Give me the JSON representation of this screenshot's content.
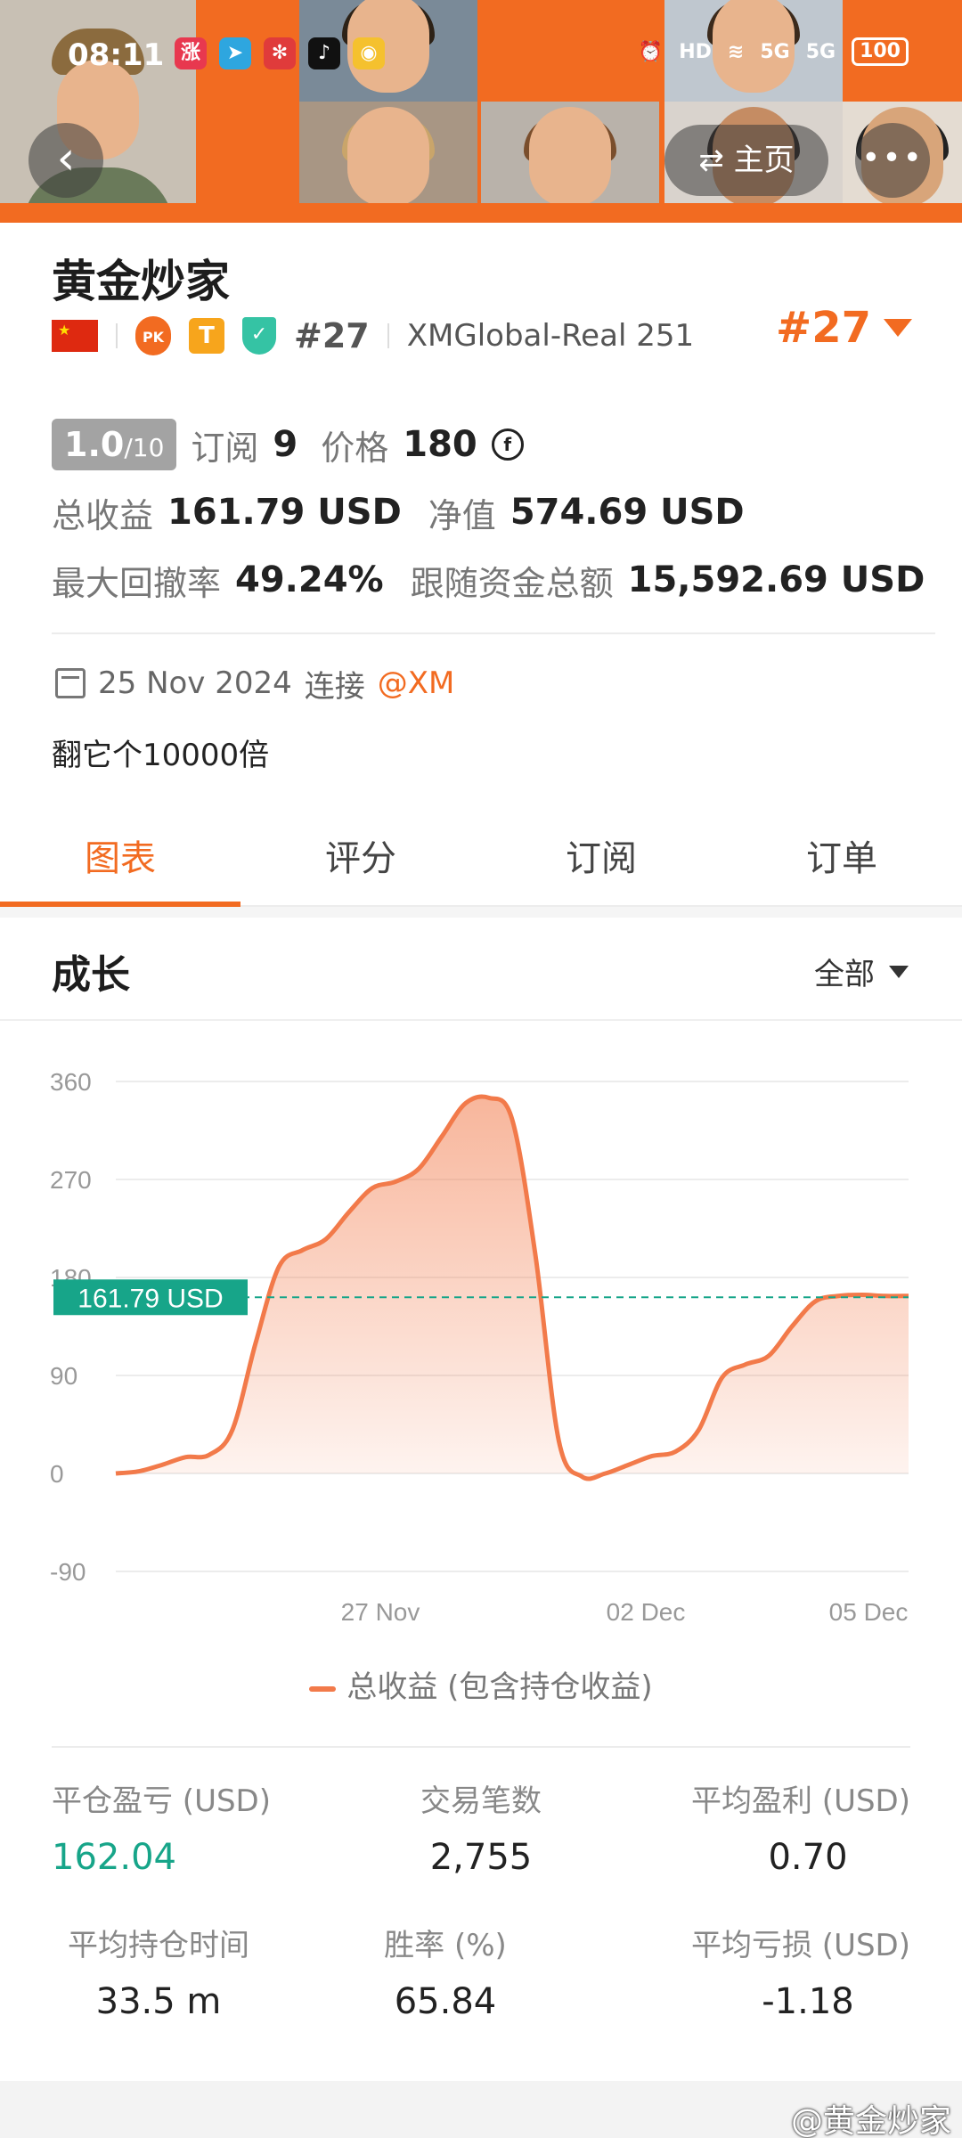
{
  "status_bar": {
    "time": "08:11",
    "network": "5G",
    "battery": "100"
  },
  "nav": {
    "home_label": "⇄ 主页"
  },
  "profile": {
    "name": "黄金炒家",
    "rank": "#27",
    "account": "XMGlobal-Real 251",
    "rank_big": "#27"
  },
  "stats": {
    "score": "1.0",
    "score_max": "/10",
    "subscribe_label": "订阅",
    "subscribe_count": "9",
    "price_label": "价格",
    "price_value": "180",
    "total_profit_label": "总收益",
    "total_profit_value": "161.79 USD",
    "net_value_label": "净值",
    "net_value_value": "574.69 USD",
    "max_drawdown_label": "最大回撤率",
    "max_drawdown_value": "49.24%",
    "follow_funds_label": "跟随资金总额",
    "follow_funds_value": "15,592.69 USD"
  },
  "connection": {
    "date": "25 Nov 2024",
    "connect_label": "连接",
    "broker": "@XM"
  },
  "bio": "翻它个10000倍",
  "tabs": [
    {
      "label": "图表",
      "active": true
    },
    {
      "label": "评分",
      "active": false
    },
    {
      "label": "订阅",
      "active": false
    },
    {
      "label": "订单",
      "active": false
    }
  ],
  "section": {
    "title": "成长",
    "range": "全部"
  },
  "chart_data": {
    "type": "area",
    "y_ticks": [
      "360",
      "270",
      "180",
      "90",
      "0",
      "-90"
    ],
    "ylim": [
      -90,
      360
    ],
    "x_tick_labels": [
      "27 Nov",
      "02 Dec",
      "05 Dec"
    ],
    "current_value_label": "161.79 USD",
    "current_value": 161.79,
    "series": [
      {
        "name": "总收益 (包含持仓收益)",
        "color": "#f27a4a",
        "values": [
          0,
          2,
          8,
          15,
          17,
          40,
          120,
          190,
          205,
          215,
          240,
          262,
          268,
          280,
          310,
          340,
          345,
          325,
          200,
          30,
          -3,
          0,
          8,
          16,
          20,
          40,
          88,
          100,
          108,
          135,
          158,
          163,
          164,
          163,
          163
        ]
      }
    ]
  },
  "legend": {
    "label": "总收益 (包含持仓收益)"
  },
  "metrics": [
    {
      "label": "平仓盈亏 (USD)",
      "value": "162.04",
      "color": "green"
    },
    {
      "label": "交易笔数",
      "value": "2,755",
      "color": "default"
    },
    {
      "label": "平均盈利 (USD)",
      "value": "0.70",
      "color": "default"
    },
    {
      "label": "平均持仓时间",
      "value": "33.5 m",
      "color": "default"
    },
    {
      "label": "胜率 (%)",
      "value": "65.84",
      "color": "default"
    },
    {
      "label": "平均亏损 (USD)",
      "value": "-1.18",
      "color": "default"
    }
  ],
  "watermark": "@黄金炒家",
  "colors": {
    "accent": "#f26b21",
    "profit_green": "#17a589",
    "line": "#f27a4a"
  }
}
